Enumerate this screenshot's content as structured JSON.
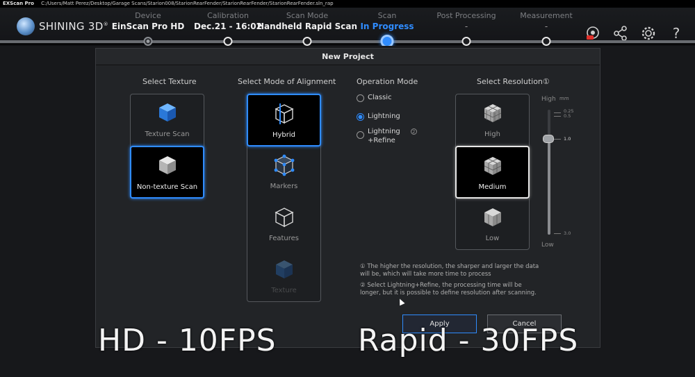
{
  "titlebar": {
    "app": "EXScan Pro",
    "path": "C:/Users/Matt Perez/Desktop/Garage Scans/Starion008/StarionRearFender/StarionRearFender/StarionRearFender.sln_rap"
  },
  "header": {
    "logo_text": "SHINING 3D",
    "logo_mark": "®",
    "steps": [
      {
        "label": "Device",
        "value": "EinScan Pro HD"
      },
      {
        "label": "Calibration",
        "value": "Dec.21 - 16:02"
      },
      {
        "label": "Scan Mode",
        "value": "Handheld Rapid Scan"
      },
      {
        "label": "Scan",
        "value": "In Progress"
      },
      {
        "label": "Post Processing",
        "value": "-"
      },
      {
        "label": "Measurement",
        "value": "-"
      }
    ],
    "icons": [
      "record-icon",
      "share-icon",
      "gear-icon",
      "help-icon"
    ]
  },
  "dialog": {
    "title": "New Project",
    "texture": {
      "title": "Select Texture",
      "options": [
        "Texture Scan",
        "Non-texture Scan"
      ],
      "selected": "Non-texture Scan"
    },
    "alignment": {
      "title": "Select Mode of Alignment",
      "options": [
        "Hybrid",
        "Markers",
        "Features",
        "Texture"
      ],
      "selected": "Hybrid"
    },
    "operation": {
      "title": "Operation Mode",
      "options": [
        "Classic",
        "Lightning",
        "Lightning",
        "+Refine"
      ],
      "selected": "Lightning"
    },
    "resolution": {
      "title": "Select Resolution①",
      "options": [
        "High",
        "Medium",
        "Low"
      ],
      "selected": "Medium",
      "slider_high": "High",
      "slider_low": "Low",
      "unit": "mm",
      "scale": [
        "0.25",
        "0.5",
        "1.0",
        "3.0"
      ],
      "value": "1.0"
    },
    "notes": [
      "① The higher the resolution, the sharper and larger the data will be, which will take more time to process",
      "② Select Lightning+Refine, the processing time will be longer, but it is possible to define resolution after scanning."
    ],
    "buttons": {
      "apply": "Apply",
      "cancel": "Cancel"
    }
  },
  "captions": {
    "left": "HD - 10FPS",
    "right": "Rapid - 30FPS"
  },
  "colors": {
    "accent": "#2f8cff",
    "background": "#0e0f11",
    "dialog": "#222427"
  }
}
